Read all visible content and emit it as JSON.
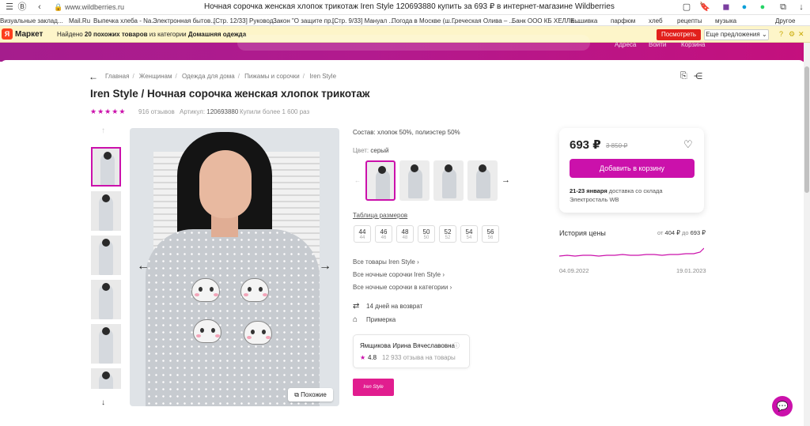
{
  "browser": {
    "url": "www.wildberries.ru",
    "title": "Ночная сорочка женская хлопок трикотаж Iren Style 120693880 купить за 693 ₽ в интернет-магазине Wildberries",
    "bookmarks": [
      "Визуальные заклад...",
      "Mail.Ru",
      "Выпечка хлеба - Na...",
      "Электронная бытов...",
      "[Стр. 12/33] Руковод...",
      "Закон \"О защите пр...",
      "[Стр. 9/33] Мануал ...",
      "Погода в Москве (ш...",
      "Греческая Олива – ...",
      "Банк ООО КБ ХЕЛЛЕ...",
      "вышивка",
      "парфюм",
      "хлеб",
      "рецепты",
      "музыка",
      "Другое"
    ]
  },
  "yandex_bar": {
    "logo": "Маркет",
    "message_prefix": "Найдено ",
    "message_count": "20 похожих товаров",
    "message_mid": " из категории ",
    "message_category": "Домашняя одежда",
    "look_button": "Посмотреть",
    "more_button": "Еще предложения"
  },
  "site_header": {
    "nav": [
      "Адреса",
      "Войти",
      "Корзина"
    ]
  },
  "breadcrumb": [
    "Главная",
    "Женщинам",
    "Одежда для дома",
    "Пижамы и сорочки",
    "Iren Style"
  ],
  "product": {
    "title": "Iren Style / Ночная сорочка женская хлопок трикотаж",
    "rating_stars": 5,
    "reviews": "916 отзывов",
    "article_label": "Артикул:",
    "article": "120693880",
    "bought": "Купили более 1 600 раз",
    "composition": "Состав: хлопок 50%, полиэстер 50%",
    "color_label": "Цвет:",
    "color_value": "серый",
    "size_table_link": "Таблица размеров",
    "sizes": [
      {
        "ru": "44",
        "sub": "44"
      },
      {
        "ru": "46",
        "sub": "46"
      },
      {
        "ru": "48",
        "sub": "48"
      },
      {
        "ru": "50",
        "sub": "50"
      },
      {
        "ru": "52",
        "sub": "52"
      },
      {
        "ru": "54",
        "sub": "54"
      },
      {
        "ru": "56",
        "sub": "56"
      }
    ],
    "links": [
      "Все товары Iren Style",
      "Все ночные сорочки Iren Style",
      "Все ночные сорочки в категории"
    ],
    "returns": "14 дней на возврат",
    "fitting": "Примерка",
    "similar_button": "Похожие"
  },
  "seller": {
    "name": "Ямщикова Ирина Вячеславовна",
    "rating": "4.8",
    "reviews": "12 933 отзыва на товары",
    "brand_logo_text": "Iren Style"
  },
  "price_card": {
    "price": "693 ₽",
    "old_price": "3 850 ₽",
    "add_to_cart": "Добавить в корзину",
    "delivery_date": "21-23 января",
    "delivery_text": " доставка со склада",
    "warehouse": "Электросталь WB"
  },
  "price_history": {
    "title": "История цены",
    "range_from_label": "от ",
    "range_from": "404 ₽",
    "range_to_label": " до ",
    "range_to": "693 ₽",
    "date_start": "04.09.2022",
    "date_end": "19.01.2023",
    "accent_color": "#cb11ab"
  },
  "colors": {
    "brand": "#cb11ab",
    "header_gradient_start": "#a51d8d",
    "header_gradient_end": "#c4107d",
    "yandex_bar": "#fdf5c9"
  },
  "icons": [
    "back-arrow-icon",
    "star-icon",
    "heart-icon",
    "share-icon",
    "compare-icon",
    "return-icon",
    "hanger-icon",
    "info-icon",
    "chat-icon",
    "chevron-right-icon",
    "chevron-down-icon",
    "chevron-up-icon",
    "arrow-left-icon",
    "arrow-right-icon"
  ]
}
